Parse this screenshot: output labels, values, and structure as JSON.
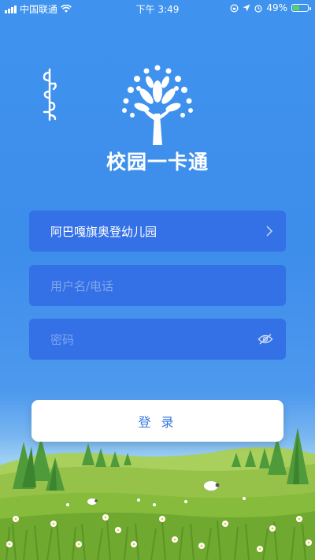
{
  "status_bar": {
    "carrier": "中国联通",
    "time": "下午 3:49",
    "battery": "49%",
    "battery_level": 0.49
  },
  "app": {
    "title": "校园一卡通"
  },
  "form": {
    "school_value": "阿巴嘎旗奥登幼儿园",
    "username_placeholder": "用户名/电话",
    "password_placeholder": "密码",
    "login_label": "登 录"
  },
  "icons": {
    "school_picker": "chevron-right-icon",
    "password_toggle": "eye-off-icon"
  }
}
